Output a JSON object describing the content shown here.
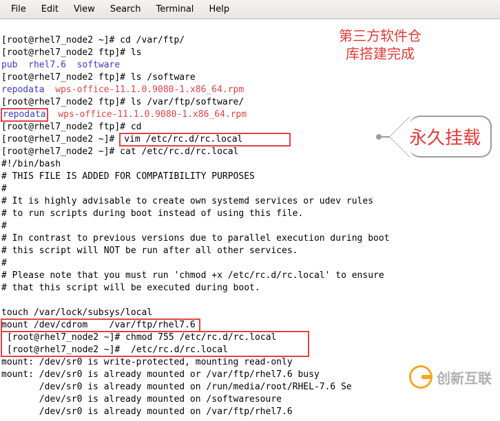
{
  "menu": {
    "file": "File",
    "edit": "Edit",
    "view": "View",
    "search": "Search",
    "terminal": "Terminal",
    "help": "Help"
  },
  "term": {
    "l1": "[root@rhel7_node2 ~]# cd /var/ftp/",
    "l2": "[root@rhel7_node2 ftp]# ls",
    "l3a": "pub",
    "l3b": "rhel7.6",
    "l3c": "software",
    "l4": "[root@rhel7_node2 ftp]# ls /software",
    "l5a": "repodata",
    "l5b": "wps-office-11.1.0.9080-1.x86_64.rpm",
    "l6": "[root@rhel7_node2 ftp]# ls /var/ftp/software/",
    "l7a": "repodata",
    "l7b": "wps-office-11.1.0.9080-1.x86_64.rpm",
    "l8": "[root@rhel7_node2 ftp]# cd",
    "l9a": "[root@rhel7_node2 ~]# ",
    "l9b": "vim /etc/rc.d/rc.local        ",
    "l10": "[root@rhel7_node2 ~]# cat /etc/rc.d/rc.local",
    "l11": "#!/bin/bash",
    "l12": "# THIS FILE IS ADDED FOR COMPATIBILITY PURPOSES",
    "l13": "#",
    "l14": "# It is highly advisable to create own systemd services or udev rules",
    "l15": "# to run scripts during boot instead of using this file.",
    "l16": "#",
    "l17": "# In contrast to previous versions due to parallel execution during boot",
    "l18": "# this script will NOT be run after all other services.",
    "l19": "#",
    "l20": "# Please note that you must run 'chmod +x /etc/rc.d/rc.local' to ensure",
    "l21": "# that this script will be executed during boot.",
    "l22": "",
    "l23": "touch /var/lock/subsys/local",
    "l24": "mount /dev/cdrom    /var/ftp/rhel7.6",
    "l25a": "[root@rhel7_node2 ~]#",
    "l25b": " chmod 755 /etc/rc.d/rc.local     ",
    "l26a": "[root@rhel7_node2 ~]#",
    "l26b": "  /etc/rc.d/rc.local",
    "l27": "mount: /dev/sr0 is write-protected, mounting read-only",
    "l28": "mount: /dev/sr0 is already mounted or /var/ftp/rhel7.6 busy",
    "l29": "       /dev/sr0 is already mounted on /run/media/root/RHEL-7.6 Se",
    "l30": "       /dev/sr0 is already mounted on /softwaresoure",
    "l31": "       /dev/sr0 is already mounted on /var/ftp/rhel7.6"
  },
  "annotation": {
    "a1_line1": "第三方软件仓",
    "a1_line2": "库搭建完成",
    "a2": "永久挂载"
  },
  "watermark": {
    "text": "创新互联"
  }
}
